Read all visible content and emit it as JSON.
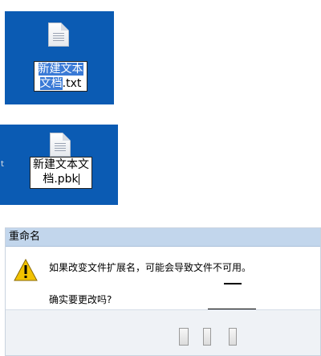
{
  "desktop_top": {
    "filename_selected": "新建文本文档",
    "filename_ext": ".txt"
  },
  "desktop_bottom": {
    "filename": "新建文本文档.pbk",
    "left_edge_glyph": "t"
  },
  "dialog": {
    "title": "重命名",
    "message_line1": "如果改变文件扩展名，可能会导致文件不可用。",
    "message_line2": "确实要更改吗?",
    "icon": "warning-icon",
    "accent": "#c2d6ec"
  }
}
